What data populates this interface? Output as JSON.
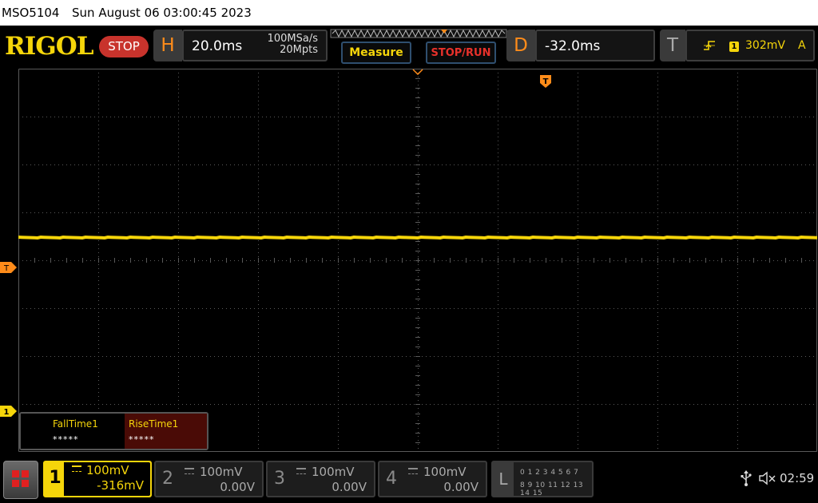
{
  "header": {
    "model": "MSO5104",
    "datetime": "Sun August 06 03:00:45 2023",
    "brand": "RIGOL",
    "run_status": "STOP"
  },
  "horizontal": {
    "label": "H",
    "timebase": "20.0ms",
    "sample_rate": "100MSa/s",
    "memory_depth": "20Mpts"
  },
  "buttons": {
    "measure": "Measure",
    "stop_run": "STOP/RUN"
  },
  "delay": {
    "label": "D",
    "value": "-32.0ms"
  },
  "trigger": {
    "label": "T",
    "source": "1",
    "level": "302mV",
    "mode": "A",
    "edge_icon": "rising-edge-icon"
  },
  "markers": {
    "trigger_level": "T",
    "ch1_offset": "1",
    "delay": "T"
  },
  "measurements": [
    {
      "name": "FallTime1",
      "value": "*****"
    },
    {
      "name": "RiseTime1",
      "value": "*****"
    }
  ],
  "channels": [
    {
      "num": "1",
      "coupling_icon": "dc-coupling-icon",
      "scale": "100mV",
      "offset": "-316mV",
      "color": "#f5d50a",
      "active": true
    },
    {
      "num": "2",
      "coupling_icon": "dc-coupling-icon",
      "scale": "100mV",
      "offset": "0.00V",
      "color": "#8a8a8a",
      "active": false
    },
    {
      "num": "3",
      "coupling_icon": "dc-coupling-icon",
      "scale": "100mV",
      "offset": "0.00V",
      "color": "#8a8a8a",
      "active": false
    },
    {
      "num": "4",
      "coupling_icon": "dc-coupling-icon",
      "scale": "100mV",
      "offset": "0.00V",
      "color": "#8a8a8a",
      "active": false
    }
  ],
  "logic": {
    "label": "L",
    "row1": "0 1 2 3  4 5 6 7",
    "row2": "8 9 10 11 12 13 14 15"
  },
  "system": {
    "clock": "02:59",
    "usb_icon": "usb-icon",
    "sound_icon": "speaker-muted-icon"
  },
  "colors": {
    "ch1": "#f5d50a",
    "accent_orange": "#ff8c1a",
    "stop_red": "#c8332c",
    "grid": "#5a5a5a"
  }
}
